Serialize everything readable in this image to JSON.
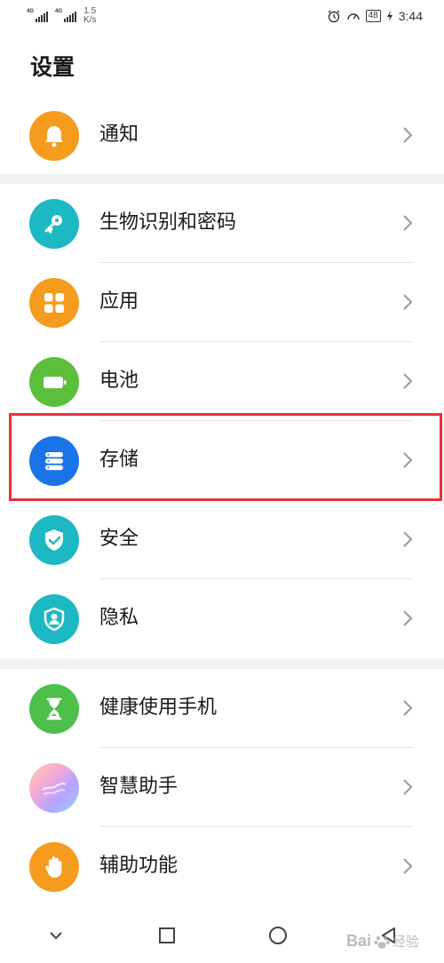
{
  "status_bar": {
    "signal_1_tag": "4G",
    "signal_2_tag": "4G",
    "net_speed_value": "1.5",
    "net_speed_unit": "K/s",
    "battery": "48",
    "time": "3:44"
  },
  "page_title": "设置",
  "groups": [
    {
      "items": [
        {
          "label": "通知",
          "icon": "bell-icon",
          "color": "#f59b1e"
        }
      ]
    },
    {
      "items": [
        {
          "label": "生物识别和密码",
          "icon": "key-icon",
          "color": "#1cb8c4"
        },
        {
          "label": "应用",
          "icon": "apps-grid-icon",
          "color": "#f59b1e"
        },
        {
          "label": "电池",
          "icon": "battery-icon",
          "color": "#5cbf3c"
        },
        {
          "label": "存储",
          "icon": "storage-icon",
          "color": "#1a74e8"
        },
        {
          "label": "安全",
          "icon": "shield-check-icon",
          "color": "#1cb8c4"
        },
        {
          "label": "隐私",
          "icon": "privacy-icon",
          "color": "#1cb8c4"
        }
      ]
    },
    {
      "items": [
        {
          "label": "健康使用手机",
          "icon": "hourglass-icon",
          "color": "#4cc04a"
        },
        {
          "label": "智慧助手",
          "icon": "assistant-orb-icon",
          "color": "#c8a6ff"
        },
        {
          "label": "辅助功能",
          "icon": "hand-icon",
          "color": "#f59b1e"
        }
      ]
    }
  ],
  "highlight_color": "#e8323c",
  "watermark": {
    "brand": "Bai",
    "brand_tail": "经验"
  }
}
